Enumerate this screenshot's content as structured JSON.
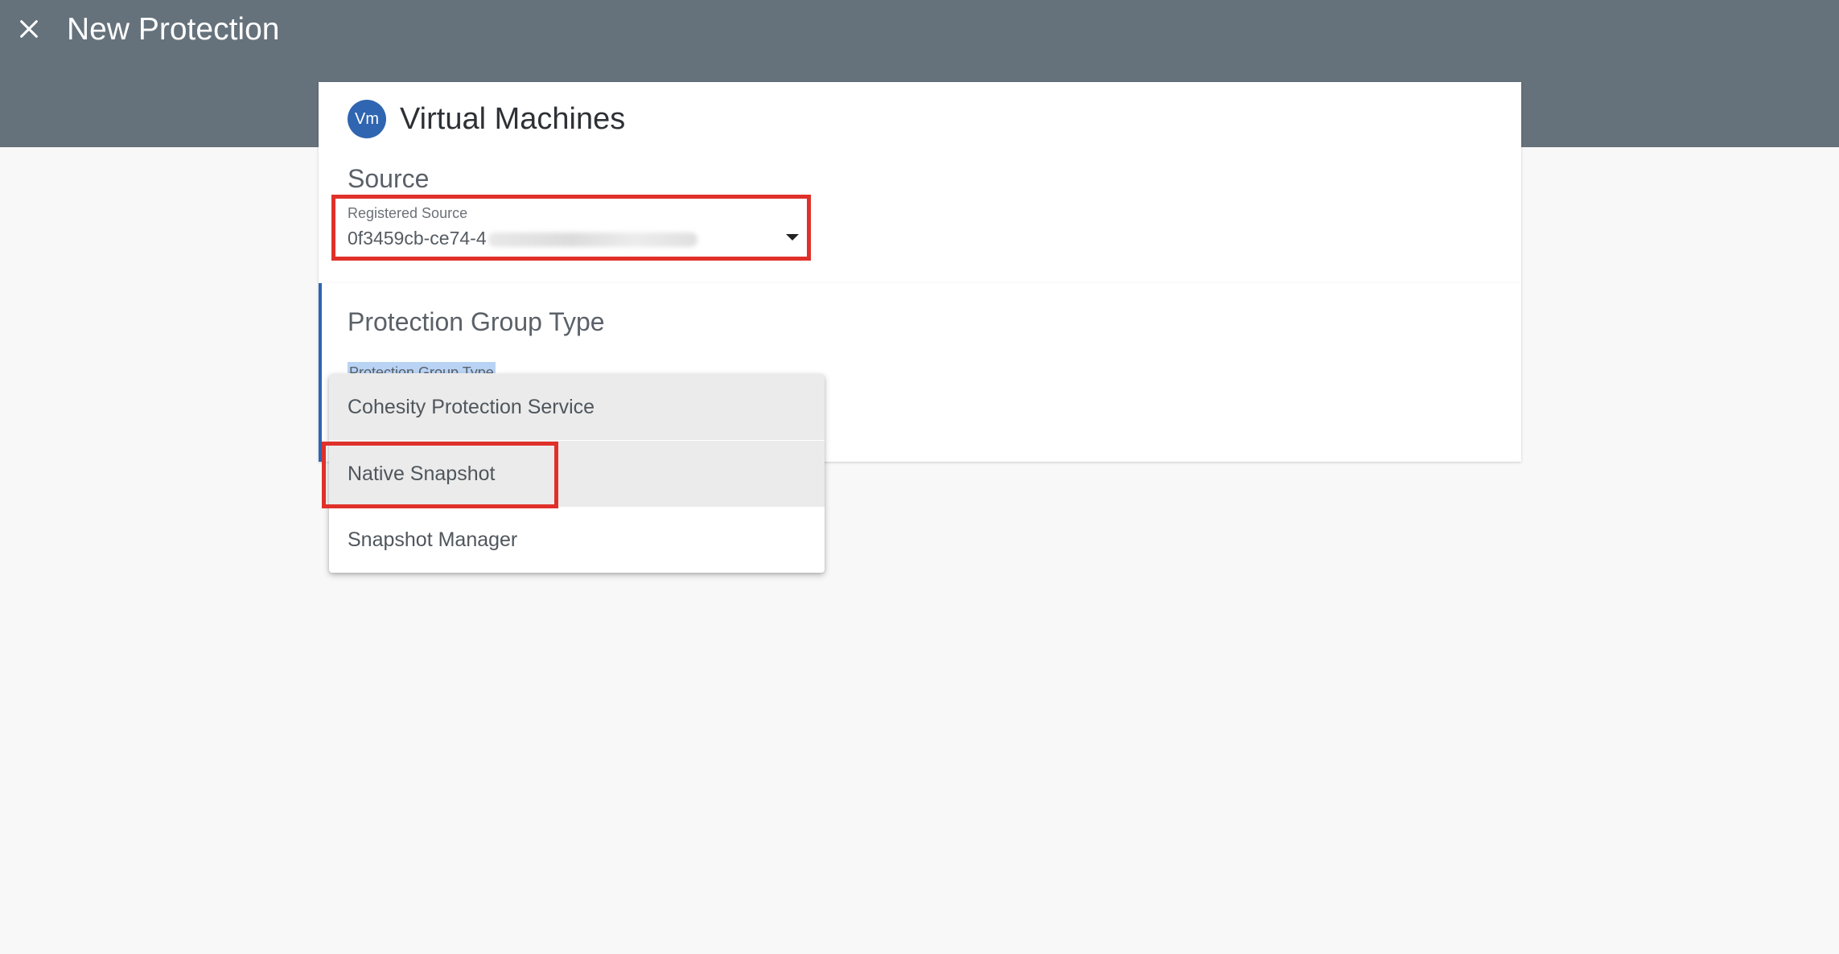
{
  "header": {
    "title": "New Protection",
    "close_icon": "close-icon"
  },
  "environment": {
    "avatar_text": "Vm",
    "title": "Virtual Machines"
  },
  "source_section": {
    "title": "Source",
    "field_label": "Registered Source",
    "field_value_visible": "0f3459cb-ce74-4",
    "dropdown_icon": "caret-down-icon"
  },
  "protection_group_type": {
    "title": "Protection Group Type",
    "field_label": "Protection Group Type",
    "options": [
      "Cohesity Protection Service",
      "Native Snapshot",
      "Snapshot Manager"
    ]
  },
  "colors": {
    "header_bg": "#66727b",
    "accent": "#2f65b1",
    "highlight_border": "#e0302a",
    "page_bg": "#f8f8f8"
  }
}
